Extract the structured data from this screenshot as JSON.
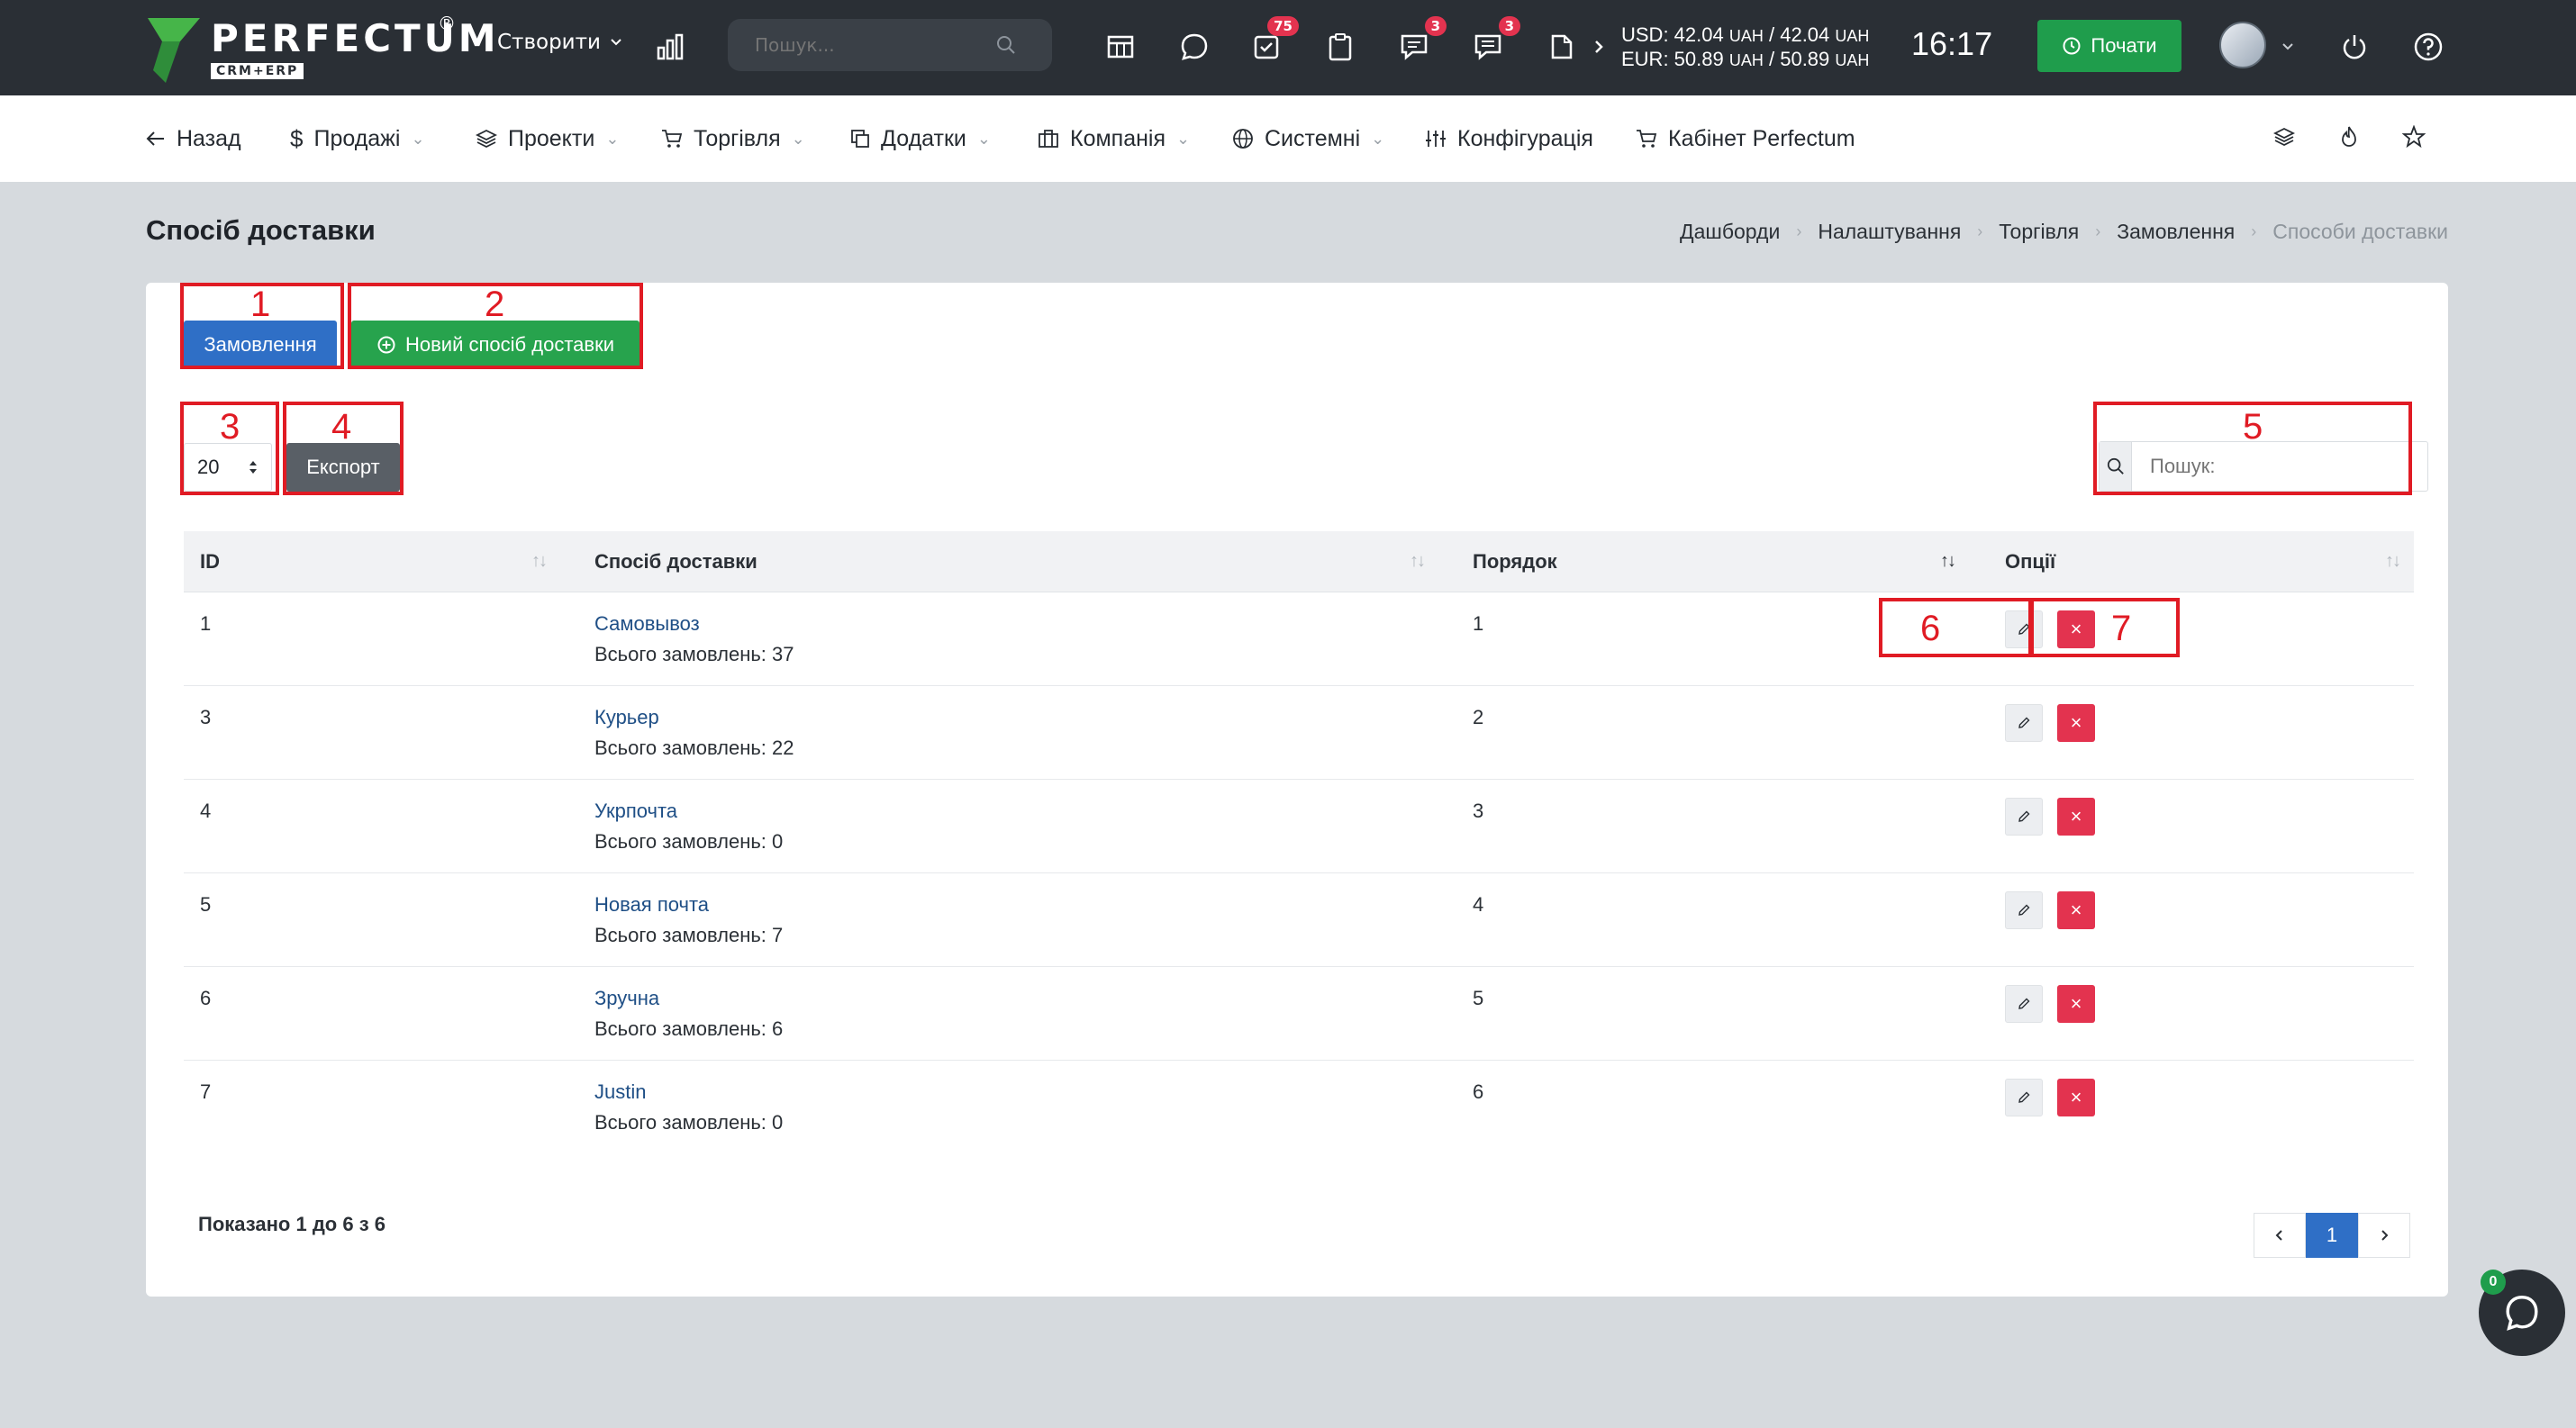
{
  "header": {
    "logo_text": "PERFECTUM",
    "logo_sub": "CRM+ERP",
    "logo_reg": "®",
    "create_label": "Створити",
    "search_placeholder": "Пошук...",
    "badges": {
      "tasks": "75",
      "chat": "3",
      "messages": "3"
    },
    "currency_usd": "USD: 42.04",
    "currency_usd_unit": "UAH",
    "currency_usd_rate2": "/ 42.04",
    "currency_eur": "EUR: 50.89",
    "currency_eur_unit": "UAH",
    "currency_eur_rate2": "/ 50.89",
    "time": "16:17",
    "start_label": "Почати"
  },
  "nav": {
    "back": "Назад",
    "sales": "Продажі",
    "projects": "Проекти",
    "trade": "Торгівля",
    "addons": "Додатки",
    "company": "Компанія",
    "system": "Системні",
    "config": "Конфігурація",
    "cabinet": "Кабінет Perfectum"
  },
  "page": {
    "title": "Спосіб доставки",
    "breadcrumb": [
      "Дашборди",
      "Налаштування",
      "Торгівля",
      "Замовлення",
      "Способи доставки"
    ]
  },
  "toolbar": {
    "orders_label": "Замовлення",
    "new_label": "Новий спосіб доставки",
    "page_size": "20",
    "export_label": "Експорт",
    "search_placeholder": "Пошук:"
  },
  "table": {
    "headers": [
      "ID",
      "Спосіб доставки",
      "Порядок",
      "Опції"
    ],
    "rows": [
      {
        "id": "1",
        "name": "Самовывоз",
        "count": "Всього замовлень: 37",
        "order": "1"
      },
      {
        "id": "3",
        "name": "Курьер",
        "count": "Всього замовлень: 22",
        "order": "2"
      },
      {
        "id": "4",
        "name": "Укрпочта",
        "count": "Всього замовлень: 0",
        "order": "3"
      },
      {
        "id": "5",
        "name": "Новая почта",
        "count": "Всього замовлень: 7",
        "order": "4"
      },
      {
        "id": "6",
        "name": "Зручна",
        "count": "Всього замовлень: 6",
        "order": "5"
      },
      {
        "id": "7",
        "name": "Justin",
        "count": "Всього замовлень: 0",
        "order": "6"
      }
    ],
    "showing": "Показано 1 до 6 з 6",
    "current_page": "1"
  },
  "annotations": [
    "1",
    "2",
    "3",
    "4",
    "5",
    "6",
    "7"
  ],
  "chat_badge": "0",
  "colors": {
    "topbar": "#2a2f35",
    "primary": "#2f6fc6",
    "success": "#27a34d",
    "danger": "#e3334f",
    "annotation": "#e01b24"
  }
}
